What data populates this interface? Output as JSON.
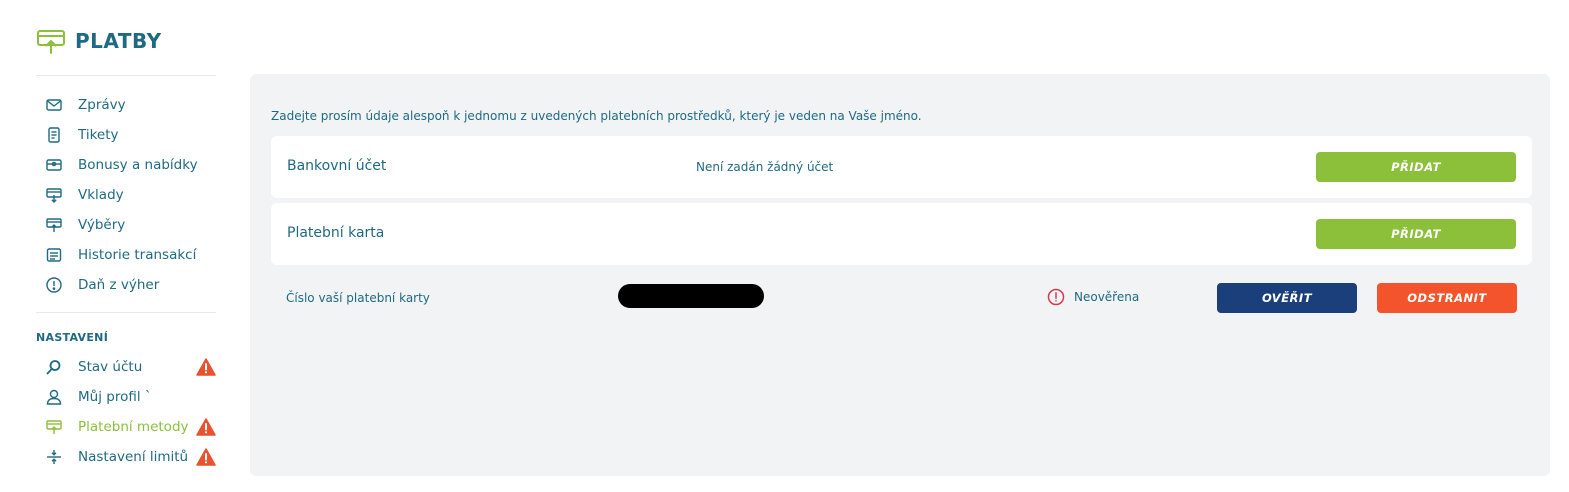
{
  "header": {
    "title": "PLATBY",
    "icon": "payments-icon"
  },
  "sidebar": {
    "items": [
      {
        "label": "Zprávy",
        "icon": "mail-icon"
      },
      {
        "label": "Tikety",
        "icon": "ticket-icon"
      },
      {
        "label": "Bonusy a nabídky",
        "icon": "bonus-icon"
      },
      {
        "label": "Vklady",
        "icon": "deposit-icon"
      },
      {
        "label": "Výběry",
        "icon": "withdraw-icon"
      },
      {
        "label": "Historie transakcí",
        "icon": "history-icon"
      },
      {
        "label": "Daň z výher",
        "icon": "tax-icon"
      }
    ],
    "settings_title": "NASTAVENÍ",
    "settings_items": [
      {
        "label": "Stav účtu",
        "icon": "search-icon",
        "warning": true
      },
      {
        "label": "Můj profil `",
        "icon": "user-icon",
        "warning": false
      },
      {
        "label": "Platební metody",
        "icon": "payment-methods-icon",
        "warning": true,
        "active": true
      },
      {
        "label": "Nastavení limitů",
        "icon": "limits-icon",
        "warning": true
      }
    ]
  },
  "main": {
    "intro": "Zadejte prosím údaje alespoň k jednomu z uvedených platebních prostředků, který je veden na Vaše jméno.",
    "bank": {
      "label": "Bankovní účet",
      "status": "Není zadán žádný účet",
      "button": "PŘIDAT"
    },
    "card": {
      "label": "Platební karta",
      "button": "PŘIDAT"
    },
    "card_row": {
      "label": "Číslo vaší platební karty",
      "status": "Neověřena",
      "verify_button": "OVĚŘIT",
      "remove_button": "ODSTRANIT"
    }
  },
  "colors": {
    "primary_text": "#1f6a82",
    "accent_green": "#8cbf3a",
    "navy": "#1b3f7a",
    "danger": "#f4542b",
    "warning": "#e8532e",
    "panel_bg": "#f1f3f5"
  }
}
